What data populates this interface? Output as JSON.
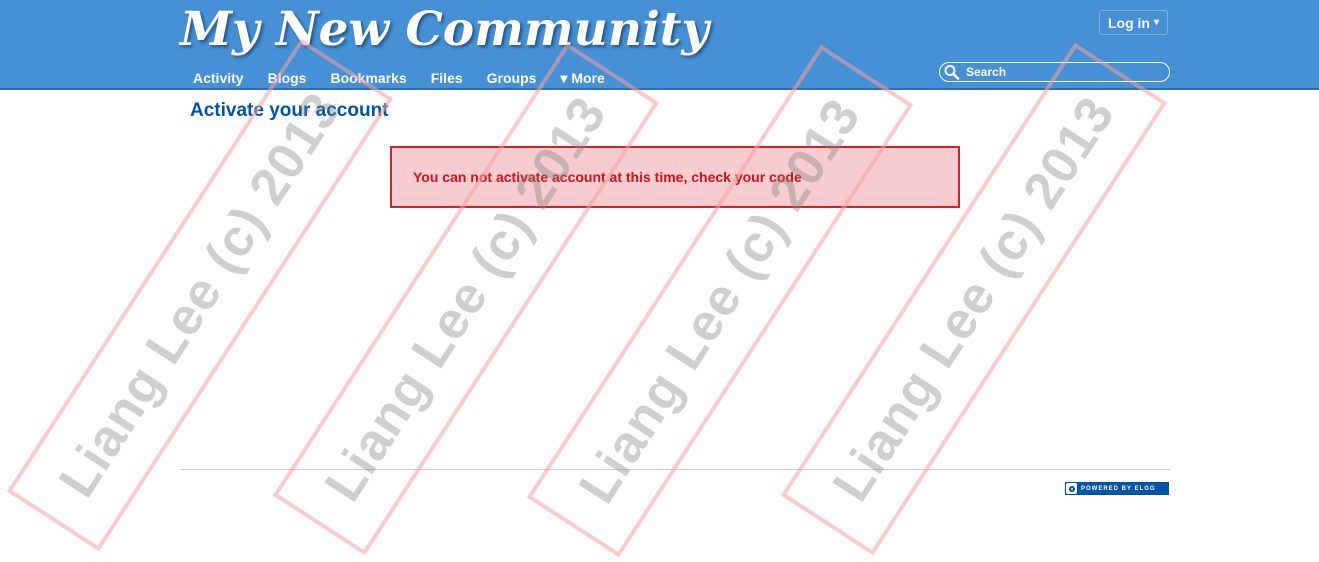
{
  "header": {
    "site_title": "My New Community",
    "login_label": "Log in",
    "login_caret": "▾",
    "nav": [
      "Activity",
      "Blogs",
      "Bookmarks",
      "Files",
      "Groups",
      "▾ More"
    ],
    "search_placeholder": "Search"
  },
  "main": {
    "title": "Activate your account",
    "error_message": "You can not activate account at this time, check your code"
  },
  "footer": {
    "powered_label": "POWERED BY ELGG"
  },
  "watermark": {
    "text": "Liang Lee (c) 2013"
  },
  "colors": {
    "header_bg": "#4690d6",
    "title_blue": "#0054a7",
    "error_border": "#d7202f",
    "error_bg": "#f7cdcf"
  }
}
